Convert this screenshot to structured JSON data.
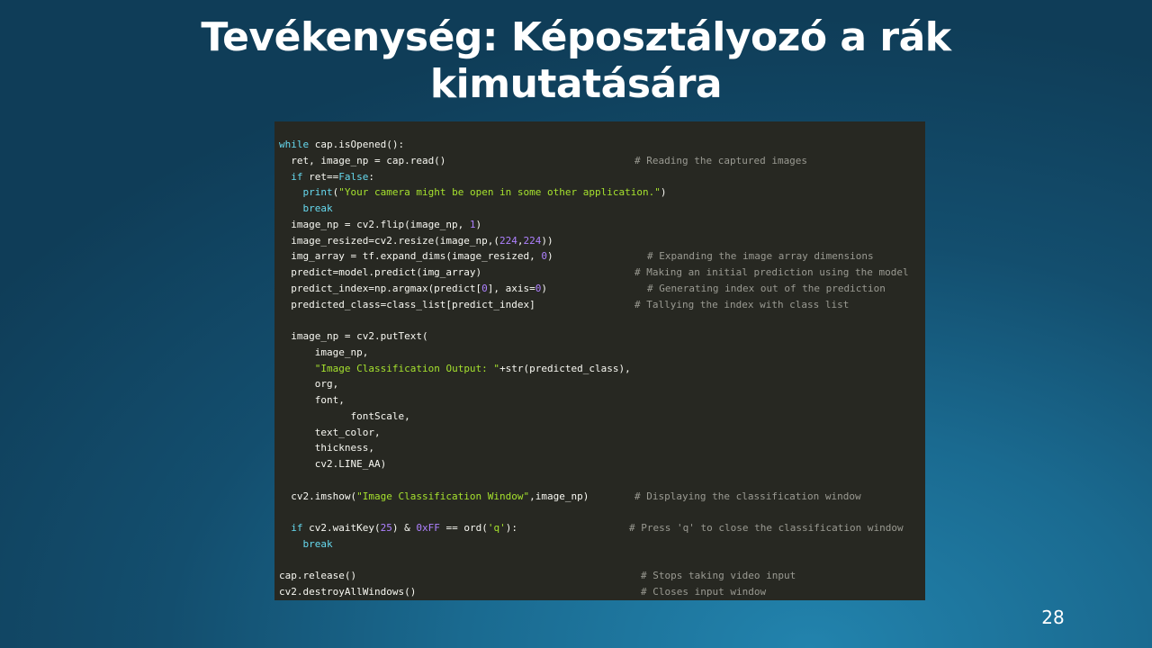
{
  "slide": {
    "title": "Tevékenység: Képosztályozó a rák kimutatására",
    "page_number": "28"
  },
  "code": {
    "lines": [
      {
        "tokens": [
          {
            "t": "while",
            "c": "kw"
          },
          {
            "t": " cap.isOpened():"
          }
        ]
      },
      {
        "tokens": [
          {
            "t": "  ret, image_np = cap.read()"
          }
        ],
        "comment": "# Reading the captured images"
      },
      {
        "tokens": [
          {
            "t": "  "
          },
          {
            "t": "if",
            "c": "kw"
          },
          {
            "t": " ret=="
          },
          {
            "t": "False",
            "c": "kw"
          },
          {
            "t": ":"
          }
        ]
      },
      {
        "tokens": [
          {
            "t": "    "
          },
          {
            "t": "print",
            "c": "kw"
          },
          {
            "t": "("
          },
          {
            "t": "\"Your camera might be open in some other application.\"",
            "c": "str"
          },
          {
            "t": ")"
          }
        ]
      },
      {
        "tokens": [
          {
            "t": "    "
          },
          {
            "t": "break",
            "c": "kw"
          }
        ]
      },
      {
        "tokens": [
          {
            "t": "  image_np = cv2.flip(image_np, "
          },
          {
            "t": "1",
            "c": "num"
          },
          {
            "t": ")"
          }
        ]
      },
      {
        "tokens": [
          {
            "t": "  image_resized=cv2.resize(image_np,("
          },
          {
            "t": "224",
            "c": "num"
          },
          {
            "t": ","
          },
          {
            "t": "224",
            "c": "num"
          },
          {
            "t": "))"
          }
        ]
      },
      {
        "tokens": [
          {
            "t": "  img_array = tf.expand_dims(image_resized, "
          },
          {
            "t": "0",
            "c": "num"
          },
          {
            "t": ")"
          }
        ],
        "comment": "# Expanding the image array dimensions"
      },
      {
        "tokens": [
          {
            "t": "  predict=model.predict(img_array)"
          }
        ],
        "comment": "# Making an initial prediction using the model"
      },
      {
        "tokens": [
          {
            "t": "  predict_index=np.argmax(predict["
          },
          {
            "t": "0",
            "c": "num"
          },
          {
            "t": "], axis="
          },
          {
            "t": "0",
            "c": "num"
          },
          {
            "t": ")"
          }
        ],
        "comment": "# Generating index out of the prediction"
      },
      {
        "tokens": [
          {
            "t": "  predicted_class=class_list[predict_index]"
          }
        ],
        "comment": "# Tallying the index with class list"
      },
      {
        "tokens": []
      },
      {
        "tokens": [
          {
            "t": "  image_np = cv2.putText("
          }
        ]
      },
      {
        "tokens": [
          {
            "t": "      image_np,"
          }
        ]
      },
      {
        "tokens": [
          {
            "t": "      "
          },
          {
            "t": "\"Image Classification Output: \"",
            "c": "str"
          },
          {
            "t": "+str(predicted_class),"
          }
        ]
      },
      {
        "tokens": [
          {
            "t": "      org,"
          }
        ]
      },
      {
        "tokens": [
          {
            "t": "      font,"
          }
        ]
      },
      {
        "tokens": [
          {
            "t": "            fontScale,"
          }
        ]
      },
      {
        "tokens": [
          {
            "t": "      text_color,"
          }
        ]
      },
      {
        "tokens": [
          {
            "t": "      thickness,"
          }
        ]
      },
      {
        "tokens": [
          {
            "t": "      cv2.LINE_AA)"
          }
        ]
      },
      {
        "tokens": []
      },
      {
        "tokens": [
          {
            "t": "  cv2.imshow("
          },
          {
            "t": "\"Image Classification Window\"",
            "c": "str"
          },
          {
            "t": ",image_np)"
          }
        ],
        "comment": "# Displaying the classification window"
      },
      {
        "tokens": []
      },
      {
        "tokens": [
          {
            "t": "  "
          },
          {
            "t": "if",
            "c": "kw"
          },
          {
            "t": " cv2.waitKey("
          },
          {
            "t": "25",
            "c": "num"
          },
          {
            "t": ") & "
          },
          {
            "t": "0xFF",
            "c": "num"
          },
          {
            "t": " == ord("
          },
          {
            "t": "'q'",
            "c": "str"
          },
          {
            "t": "):"
          }
        ],
        "comment": "# Press 'q' to close the classification window"
      },
      {
        "tokens": [
          {
            "t": "    "
          },
          {
            "t": "break",
            "c": "kw"
          }
        ]
      },
      {
        "tokens": []
      },
      {
        "tokens": [
          {
            "t": "cap.release()"
          }
        ],
        "comment": "# Stops taking video input"
      },
      {
        "tokens": [
          {
            "t": "cv2.destroyAllWindows()"
          }
        ],
        "comment": "# Closes input window"
      }
    ]
  }
}
